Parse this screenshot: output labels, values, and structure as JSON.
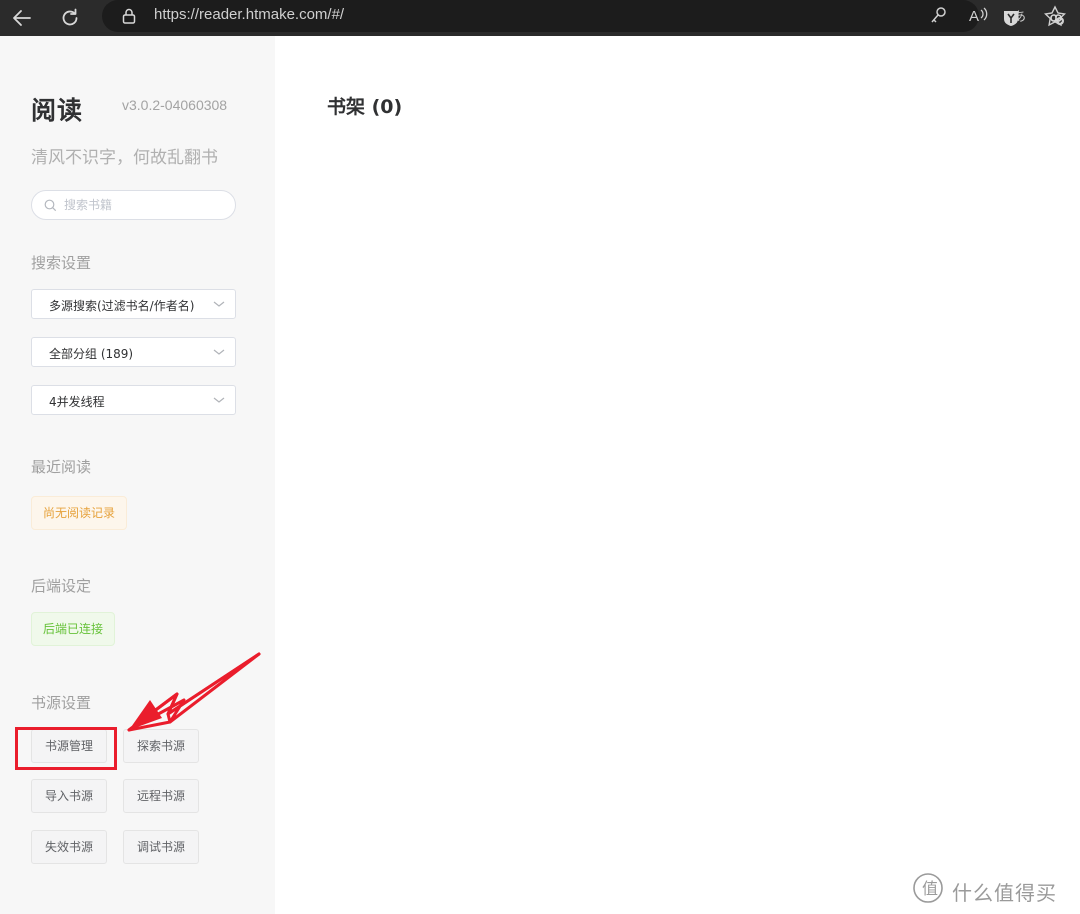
{
  "browser": {
    "url": "https://reader.htmake.com/#/",
    "colors": {
      "chrome_bg": "#2b2b2b",
      "urlbar_bg": "#1c1c1c"
    }
  },
  "sidebar": {
    "app_title": "阅读",
    "version": "v3.0.2-04060308",
    "slogan": "清风不识字，何故乱翻书",
    "search": {
      "placeholder": "搜索书籍",
      "value": ""
    },
    "search_settings": {
      "title": "搜索设置",
      "source_mode": "多源搜索(过滤书名/作者名)",
      "group": "全部分组 (189)",
      "threads": "4并发线程"
    },
    "recent": {
      "title": "最近阅读",
      "empty_text": "尚无阅读记录"
    },
    "backend": {
      "title": "后端设定",
      "status": "后端已连接"
    },
    "book_sources": {
      "title": "书源设置",
      "buttons": [
        "书源管理",
        "探索书源",
        "导入书源",
        "远程书源",
        "失效书源",
        "调试书源"
      ]
    }
  },
  "main": {
    "shelf_title": "书架 (0)"
  },
  "watermark": {
    "text": "什么值得买"
  },
  "colors": {
    "warning": "#e6a23c",
    "success": "#67c23a",
    "annotation_red": "#ea1d2c"
  }
}
